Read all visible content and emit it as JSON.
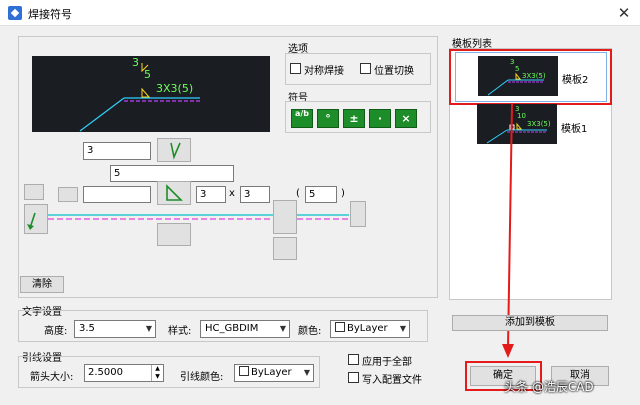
{
  "window": {
    "title": "焊接符号",
    "close": "✕"
  },
  "preview_main": {
    "top": "3",
    "mid": "5",
    "right": "3X3(5)"
  },
  "options": {
    "label": "选项",
    "symmetric": "对称焊接",
    "swap": "位置切换"
  },
  "symbols": {
    "label": "符号",
    "buttons": [
      "a/b",
      "°",
      "±",
      "·",
      "×"
    ]
  },
  "weld_fields": {
    "upper_left": "3",
    "upper_mid": "5",
    "lower_left": "",
    "size_a": "3",
    "x_label": "x",
    "size_b": "3",
    "paren_open": "(",
    "paren_value": "5",
    "paren_close": ")"
  },
  "clear_button": "清除",
  "text_settings": {
    "label": "文字设置",
    "height_label": "高度:",
    "height_value": "3.5",
    "style_label": "样式:",
    "style_value": "HC_GBDIM",
    "color_label": "颜色:",
    "color_value": "ByLayer"
  },
  "leader_settings": {
    "label": "引线设置",
    "arrow_label": "箭头大小:",
    "arrow_value": "2.5000",
    "color_label": "引线颜色:",
    "color_value": "ByLayer"
  },
  "apply_all": "应用于全部",
  "write_config": "写入配置文件",
  "template_list": {
    "label": "模板列表",
    "items": [
      {
        "name": "模板2",
        "top": "3",
        "mid": "5",
        "right": "3X3(5)"
      },
      {
        "name": "模板1",
        "top": "3",
        "mid": "10",
        "right": "3X3(5)"
      }
    ]
  },
  "add_template": "添加到模板",
  "ok_button": "确定",
  "cancel_button": "取消",
  "watermark": "头条 @浩辰CAD",
  "colors": {
    "weld_line": "#c040ff",
    "leader": "#2fd3ff",
    "text": "#6aff5a",
    "symbol": "#ffd21a",
    "select_frame": "#e31b1b"
  }
}
